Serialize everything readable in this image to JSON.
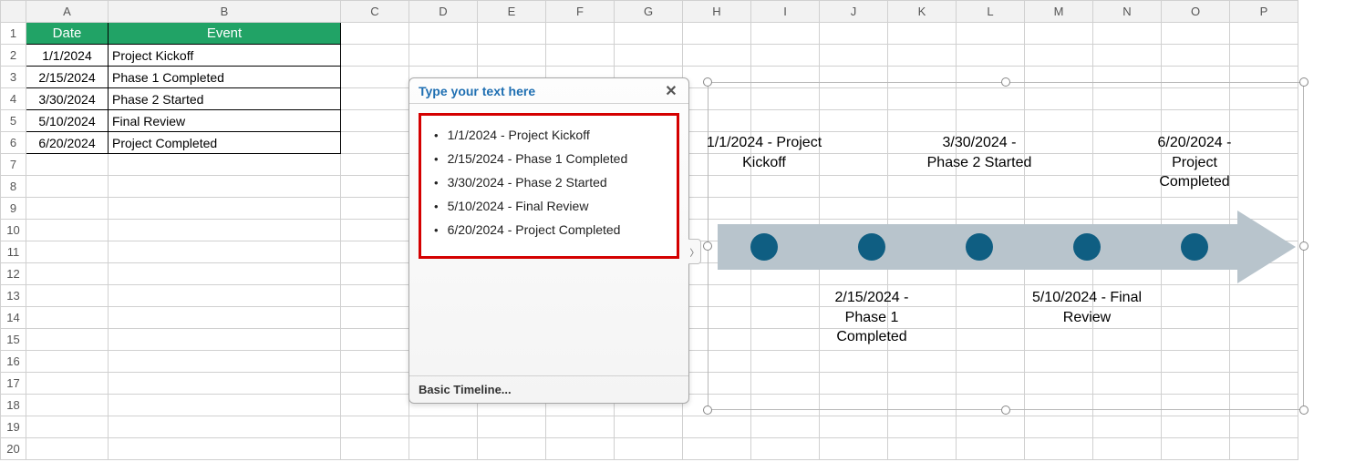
{
  "colHeaders": [
    "A",
    "B",
    "C",
    "D",
    "E",
    "F",
    "G",
    "H",
    "I",
    "J",
    "K",
    "L",
    "M",
    "N",
    "O",
    "P"
  ],
  "rowCount": 20,
  "table": {
    "headerA": "Date",
    "headerB": "Event",
    "rows": [
      {
        "date": "1/1/2024",
        "event": "Project Kickoff"
      },
      {
        "date": "2/15/2024",
        "event": "Phase 1 Completed"
      },
      {
        "date": "3/30/2024",
        "event": "Phase 2 Started"
      },
      {
        "date": "5/10/2024",
        "event": "Final Review"
      },
      {
        "date": "6/20/2024",
        "event": "Project Completed"
      }
    ]
  },
  "textPane": {
    "title": "Type your text here",
    "footer": "Basic Timeline...",
    "items": [
      "1/1/2024 - Project Kickoff",
      "2/15/2024 - Phase 1 Completed",
      "3/30/2024 - Phase 2 Started",
      "5/10/2024 - Final Review",
      "6/20/2024 - Project Completed"
    ]
  },
  "chart_data": {
    "type": "timeline",
    "title": "Basic Timeline",
    "events": [
      {
        "date": "1/1/2024",
        "label": "Project Kickoff",
        "position": "top"
      },
      {
        "date": "2/15/2024",
        "label": "Phase 1 Completed",
        "position": "bottom"
      },
      {
        "date": "3/30/2024",
        "label": "Phase 2 Started",
        "position": "top"
      },
      {
        "date": "5/10/2024",
        "label": "Final Review",
        "position": "bottom"
      },
      {
        "date": "6/20/2024",
        "label": "Project Completed",
        "position": "top"
      }
    ],
    "arrowColor": "#b8c4cc",
    "dotColor": "#0f5e82"
  }
}
